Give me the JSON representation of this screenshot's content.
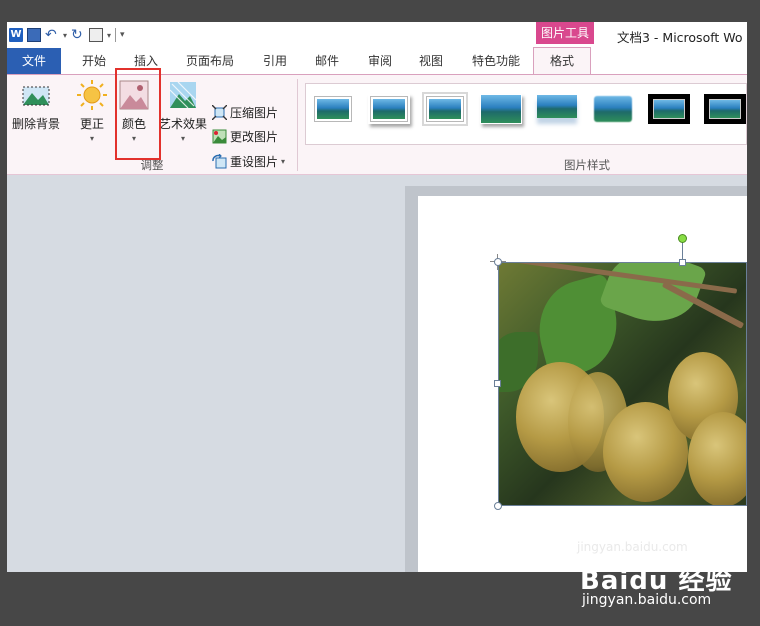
{
  "title_bar": {
    "document_title": "文档3 - Microsoft Wo",
    "context_group": "图片工具"
  },
  "quick_access": {
    "icons": [
      "word-app-icon",
      "save-icon",
      "undo-icon",
      "redo-icon",
      "print-preview-icon",
      "customize-icon"
    ]
  },
  "tabs": [
    {
      "label": "文件"
    },
    {
      "label": "开始"
    },
    {
      "label": "插入"
    },
    {
      "label": "页面布局"
    },
    {
      "label": "引用"
    },
    {
      "label": "邮件"
    },
    {
      "label": "审阅"
    },
    {
      "label": "视图"
    },
    {
      "label": "特色功能"
    },
    {
      "label": "格式"
    }
  ],
  "adjust_group": {
    "label": "调整",
    "remove_background": "删除背景",
    "corrections": "更正",
    "color": "颜色",
    "artistic_effects": "艺术效果",
    "compress": "压缩图片",
    "change": "更改图片",
    "reset": "重设图片"
  },
  "styles_group": {
    "label": "图片样式",
    "thumb_count": 8
  },
  "watermark": {
    "small": "jingyan.baidu.com",
    "brand": "Baidu 经验",
    "url": "jingyan.baidu.com"
  }
}
